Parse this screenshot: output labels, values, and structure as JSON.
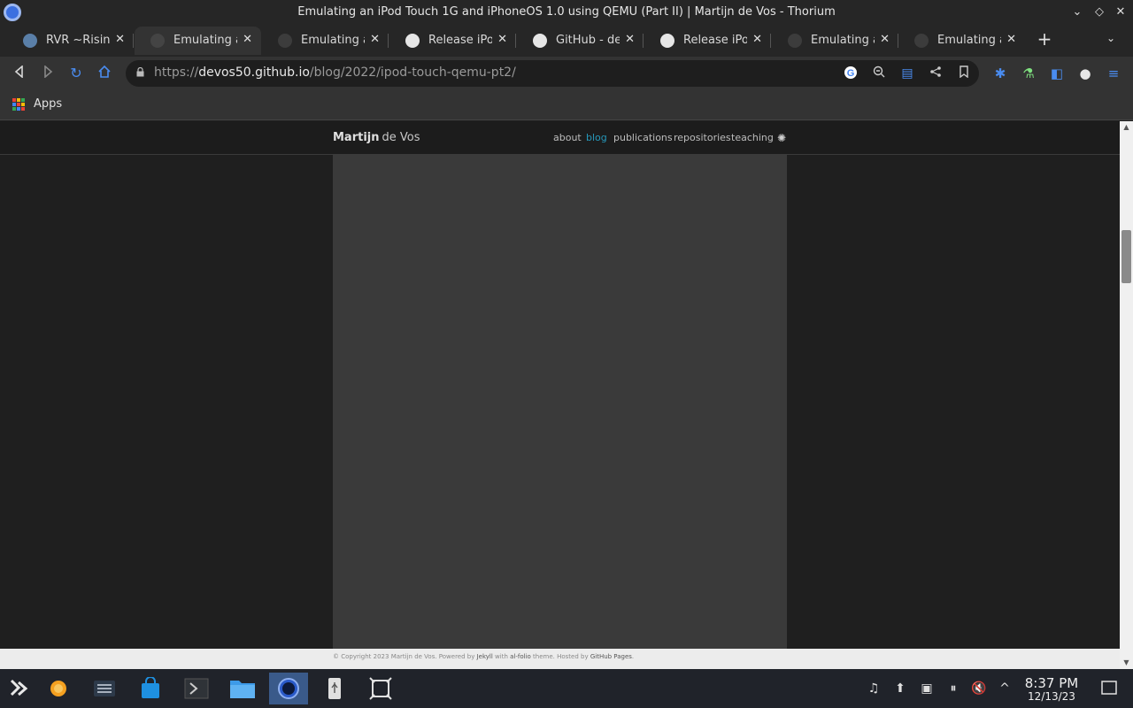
{
  "window": {
    "title": "Emulating an iPod Touch 1G and iPhoneOS 1.0 using QEMU (Part II) | Martijn de Vos - Thorium",
    "controls": [
      "chevron-down",
      "diamond",
      "close"
    ]
  },
  "tabs": [
    {
      "label": "RVR ~Rising",
      "icon": "rvr-favicon",
      "active": false
    },
    {
      "label": "Emulating an",
      "icon": "site-favicon",
      "active": true
    },
    {
      "label": "Emulating an",
      "icon": "site-favicon",
      "active": false
    },
    {
      "label": "Release iPod",
      "icon": "github-icon",
      "active": false
    },
    {
      "label": "GitHub - dev",
      "icon": "github-icon",
      "active": false
    },
    {
      "label": "Release iPod",
      "icon": "github-icon",
      "active": false
    },
    {
      "label": "Emulating an",
      "icon": "site-favicon",
      "active": false
    },
    {
      "label": "Emulating an",
      "icon": "site-favicon",
      "active": false
    }
  ],
  "toolbar": {
    "url_prefix": "https://",
    "url_host": "devos50.github.io",
    "url_path": "/blog/2022/ipod-touch-qemu-pt2/"
  },
  "bookmarks": {
    "apps_label": "Apps"
  },
  "site": {
    "brand_first": "Martijn",
    "brand_last": "de Vos",
    "nav": [
      {
        "label": "about",
        "active": false
      },
      {
        "label": "blog",
        "active": true
      },
      {
        "label": "publications",
        "active": false
      },
      {
        "label": "repositories",
        "active": false
      },
      {
        "label": "teaching",
        "active": false
      }
    ],
    "footer": {
      "copyright": "© Copyright 2023 Martijn de Vos. Powered by ",
      "jekyll": "Jekyll",
      "with": " with ",
      "theme": "al-folio",
      "theme_suffix": " theme. Hosted by ",
      "host": "GitHub Pages",
      "end": "."
    }
  },
  "taskbar": {
    "time": "8:37 PM",
    "date": "12/13/23"
  },
  "colors": {
    "accent": "#2698ba",
    "chrome_bg": "#333333",
    "taskbar_bg": "#20232a"
  }
}
